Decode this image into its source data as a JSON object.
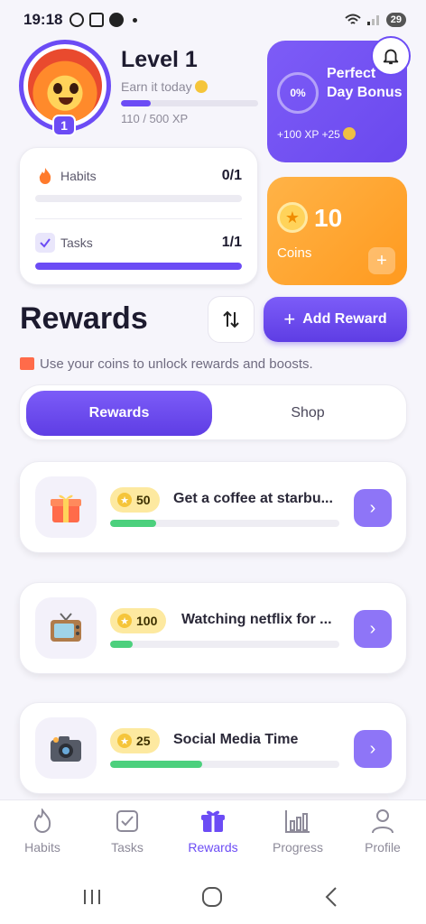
{
  "status": {
    "time": "19:18",
    "battery": "29"
  },
  "profile": {
    "level_title": "Level 1",
    "subtitle": "Earn it today",
    "xp_text": "110 / 500 XP",
    "xp_progress": 0.22,
    "badge": "1"
  },
  "perfect_day": {
    "percent": "0%",
    "title": "Perfect Day Bonus",
    "reward": "+100 XP  +25"
  },
  "stats": {
    "habits": {
      "label": "Habits",
      "value": "0/1",
      "progress": 0
    },
    "tasks": {
      "label": "Tasks",
      "value": "1/1",
      "progress": 1
    }
  },
  "coins": {
    "value": "10",
    "label": "Coins",
    "add": "+"
  },
  "rewards_section": {
    "title": "Rewards",
    "add_label": "Add Reward",
    "info": "Use your coins to unlock rewards and boosts."
  },
  "tabs": {
    "rewards": "Rewards",
    "shop": "Shop"
  },
  "rewards": [
    {
      "icon": "gift-icon",
      "cost": "50",
      "title": "Get a coffee at starbu...",
      "progress": 0.2
    },
    {
      "icon": "tv-icon",
      "cost": "100",
      "title": "Watching netflix for ...",
      "progress": 0.1
    },
    {
      "icon": "camera-icon",
      "cost": "25",
      "title": "Social Media Time",
      "progress": 0.4
    }
  ],
  "nav": {
    "habits": "Habits",
    "tasks": "Tasks",
    "rewards": "Rewards",
    "progress": "Progress",
    "profile": "Profile"
  },
  "colors": {
    "accent": "#6c4cf5",
    "coins": "#ff9a1f",
    "progress_green": "#4cd07d"
  }
}
